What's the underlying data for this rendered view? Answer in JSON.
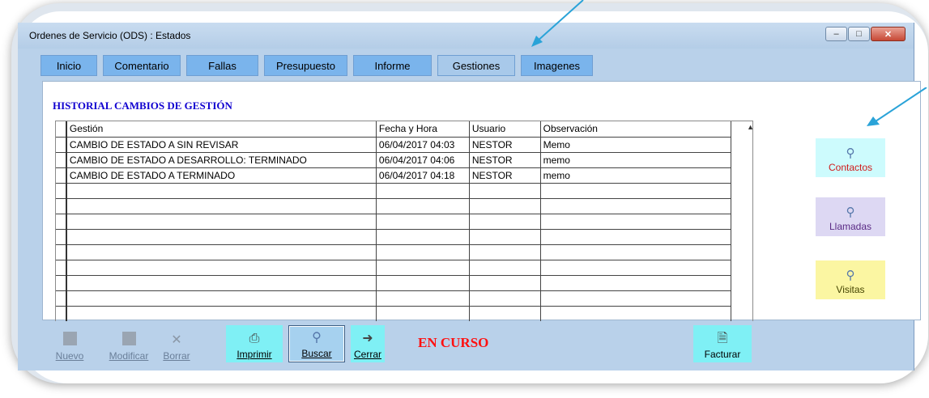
{
  "window": {
    "title": "Ordenes de Servicio (ODS) : Estados",
    "controls": {
      "minimize": "–",
      "maximize": "□",
      "close": "✕"
    }
  },
  "tabs": [
    {
      "label": "Inicio"
    },
    {
      "label": "Comentario"
    },
    {
      "label": "Fallas"
    },
    {
      "label": "Presupuesto"
    },
    {
      "label": "Informe"
    },
    {
      "label": "Gestiones",
      "active": true
    },
    {
      "label": "Imagenes"
    }
  ],
  "section_title": "HISTORIAL CAMBIOS DE GESTIÓN",
  "grid": {
    "columns": [
      "Gestión",
      "Fecha y Hora",
      "Usuario",
      "Observación"
    ],
    "rows": [
      [
        "CAMBIO DE ESTADO A SIN REVISAR",
        "06/04/2017 04:03",
        "NESTOR",
        "Memo"
      ],
      [
        "CAMBIO DE ESTADO A DESARROLLO: TERMINADO",
        "06/04/2017 04:06",
        "NESTOR",
        "memo"
      ],
      [
        "CAMBIO DE ESTADO A TERMINADO",
        "06/04/2017 04:18",
        "NESTOR",
        "memo"
      ]
    ],
    "empty_rows": 9,
    "scroll_icon": "chevron-up-icon"
  },
  "side_buttons": {
    "contactos": {
      "label": "Contactos",
      "icon": "search-icon",
      "bg": "#cdfbfd",
      "color": "#d11a1a"
    },
    "llamadas": {
      "label": "Llamadas",
      "icon": "search-icon",
      "bg": "#ddd8f3",
      "color": "#5a2a85"
    },
    "visitas": {
      "label": "Visitas",
      "icon": "search-icon",
      "bg": "#fbf6a2",
      "color": "#444400"
    }
  },
  "toolbar": {
    "nuevo": "Nuevo",
    "modificar": "Modificar",
    "borrar": "Borrar",
    "imprimir": "Imprimir",
    "buscar": "Buscar",
    "cerrar": "Cerrar",
    "facturar": "Facturar"
  },
  "status_text": "EN CURSO",
  "colors": {
    "status": "#ff1010",
    "section_title": "#1000d0",
    "tab": "#7ab4ec",
    "window_bg": "#b9d1ea"
  }
}
